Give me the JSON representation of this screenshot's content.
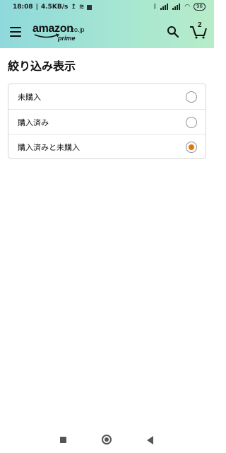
{
  "status": {
    "time": "18:08",
    "speed": "4.5KB/s",
    "battery": "96"
  },
  "header": {
    "logo_word": "amazon",
    "logo_tld": ".co.jp",
    "logo_sub": "prime",
    "cart_count": "2",
    "brand_color": "#e77600"
  },
  "page": {
    "title": "絞り込み表示"
  },
  "filter": {
    "options": [
      {
        "label": "未購入",
        "selected": false
      },
      {
        "label": "購入済み",
        "selected": false
      },
      {
        "label": "購入済みと未購入",
        "selected": true
      }
    ]
  }
}
